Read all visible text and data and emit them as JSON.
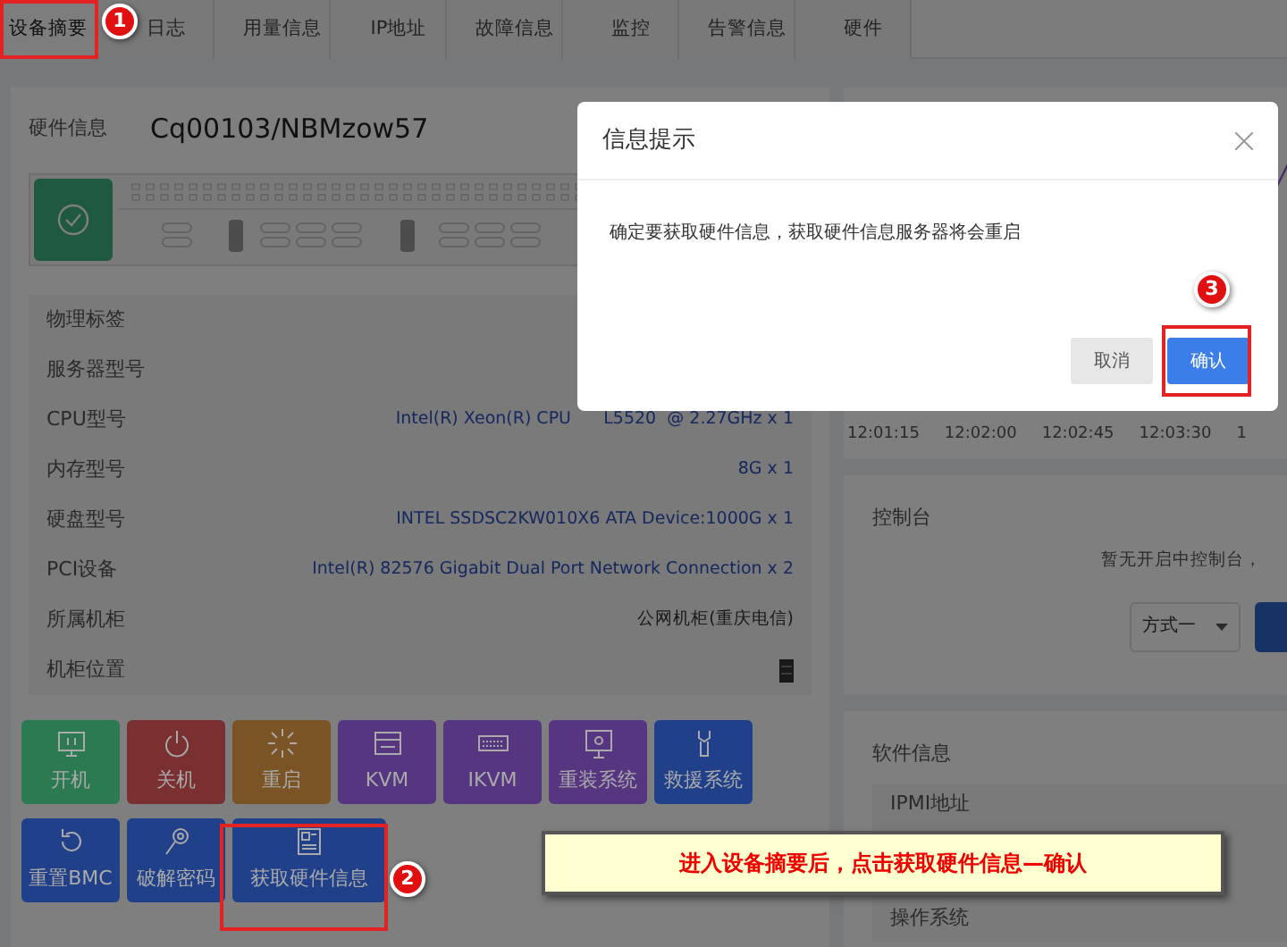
{
  "tabs": [
    {
      "label": "设备摘要",
      "selected": true
    },
    {
      "label": "日志",
      "selected": false
    },
    {
      "label": "用量信息",
      "selected": false
    },
    {
      "label": "IP地址",
      "selected": false
    },
    {
      "label": "故障信息",
      "selected": false
    },
    {
      "label": "监控",
      "selected": false
    },
    {
      "label": "告警信息",
      "selected": false
    },
    {
      "label": "硬件",
      "selected": false
    }
  ],
  "hardware": {
    "title": "硬件信息",
    "hostname": "Cq00103/NBMzow57",
    "rows": [
      {
        "label": "物理标签",
        "kind": "empty"
      },
      {
        "label": "服务器型号",
        "kind": "empty"
      },
      {
        "label": "CPU型号",
        "kind": "link",
        "value": "Intel(R) Xeon(R) CPU      L5520  @ 2.27GHz x 1"
      },
      {
        "label": "内存型号",
        "kind": "link",
        "value": "8G x 1"
      },
      {
        "label": "硬盘型号",
        "kind": "link",
        "value": "INTEL SSDSC2KW010X6 ATA Device:1000G x 1"
      },
      {
        "label": "PCI设备",
        "kind": "link",
        "value": "Intel(R) 82576 Gigabit Dual Port Network Connection x 2"
      },
      {
        "label": "所属机柜",
        "kind": "plain",
        "value": "公网机柜(重庆电信)"
      },
      {
        "label": "机柜位置",
        "kind": "rack"
      }
    ]
  },
  "actions": [
    [
      {
        "label": "开机",
        "color": "#2b7a52",
        "kind": "monitor"
      },
      {
        "label": "关机",
        "color": "#7a3030",
        "kind": "power"
      },
      {
        "label": "重启",
        "color": "#7a5424",
        "kind": "spinner"
      },
      {
        "label": "KVM",
        "color": "#563680",
        "kind": "kvm"
      },
      {
        "label": "IKVM",
        "color": "#563680",
        "kind": "keyboard"
      },
      {
        "label": "重装系统",
        "color": "#563680",
        "kind": "screen"
      },
      {
        "label": "救援系统",
        "color": "#21408a",
        "kind": "wrench"
      }
    ],
    [
      {
        "label": "重置BMC",
        "color": "#21408a",
        "kind": "refresh"
      },
      {
        "label": "破解密码",
        "color": "#21408a",
        "kind": "key"
      },
      {
        "label": "获取硬件信息",
        "color": "#21408a",
        "kind": "document"
      }
    ]
  ],
  "chart": {
    "time_labels": [
      "12:01:15",
      "12:02:00",
      "12:02:45",
      "12:03:30",
      "1"
    ]
  },
  "console": {
    "title": "控制台",
    "message": "暂无开启中控制台，",
    "select_value": "方式一"
  },
  "software": {
    "title": "软件信息",
    "rows": [
      "IPMI地址",
      "操作系统"
    ]
  },
  "dialog": {
    "title": "信息提示",
    "message": "确定要获取硬件信息，获取硬件信息服务器将会重启",
    "buttons": [
      {
        "label": "取消",
        "kind": "secondary"
      },
      {
        "label": "确认",
        "kind": "primary"
      }
    ]
  },
  "annotations": {
    "markers": [
      "1",
      "2",
      "3"
    ],
    "callout": "进入设备摘要后，点击获取硬件信息—确认"
  }
}
